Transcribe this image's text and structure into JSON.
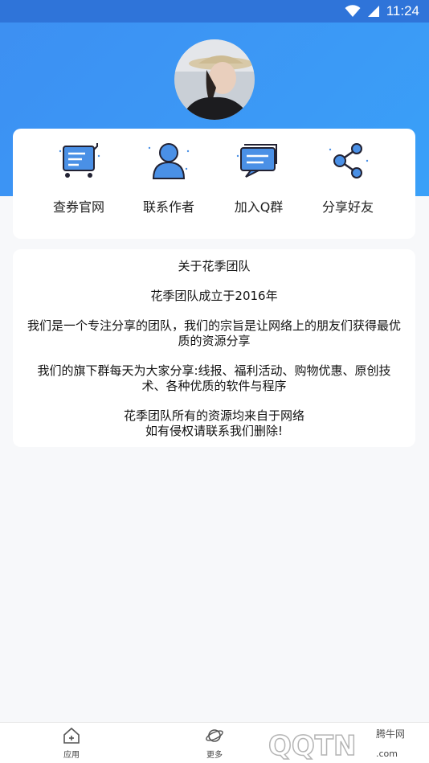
{
  "status": {
    "time": "11:24"
  },
  "menu": {
    "items": [
      {
        "label": "查券官网",
        "icon": "cart-icon"
      },
      {
        "label": "联系作者",
        "icon": "person-icon"
      },
      {
        "label": "加入Q群",
        "icon": "chat-icon"
      },
      {
        "label": "分享好友",
        "icon": "share-icon"
      }
    ]
  },
  "about": {
    "title": "关于花季团队",
    "founded": "花季团队成立于2016年",
    "mission_1": "我们是一个专注分享的团队，我们的宗旨是让网络上的朋友们获得最优",
    "mission_2": "质的资源分享",
    "daily_1": "我们的旗下群每天为大家分享:线报、福利活动、购物优惠、原创技",
    "daily_2": "术、各种优质的软件与程序",
    "source_1": "花季团队所有的资源均来自于网络",
    "source_2": "如有侵权请联系我们删除!"
  },
  "tabbar": {
    "tabs": [
      {
        "label": "应用",
        "icon": "home-icon"
      },
      {
        "label": "更多",
        "icon": "planet-icon"
      }
    ]
  },
  "watermark": {
    "text": "腾牛网",
    "logo": "QQTN"
  },
  "colors": {
    "accent": "#3d8ff2",
    "icon_blue": "#3f86e6",
    "status_bar": "#2f74d9"
  }
}
